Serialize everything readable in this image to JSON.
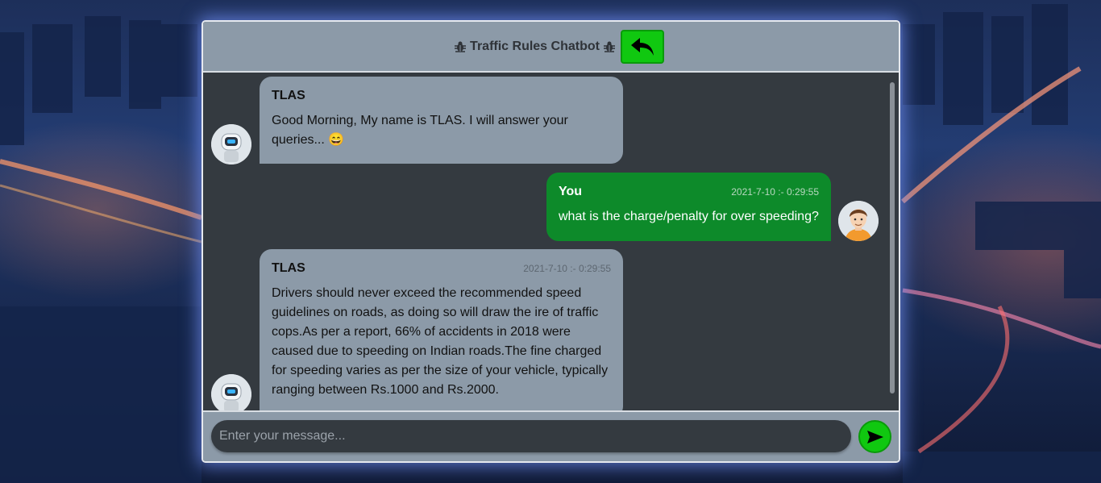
{
  "header": {
    "title": "Traffic Rules Chatbot"
  },
  "messages": [
    {
      "sender": "TLAS",
      "time": "",
      "text": "Good Morning, My name is TLAS. I will answer your queries... 😄"
    },
    {
      "sender": "You",
      "time": "2021-7-10 :- 0:29:55",
      "text": "what is the charge/penalty for over speeding?"
    },
    {
      "sender": "TLAS",
      "time": "2021-7-10 :- 0:29:55",
      "text": "Drivers should never exceed the recommended speed guidelines on roads, as doing so will draw the ire of traffic cops.As per a report, 66% of accidents in 2018 were caused due to speeding on Indian roads.The fine charged for speeding varies as per the size of your vehicle, typically ranging between Rs.1000 and Rs.2000."
    }
  ],
  "input": {
    "placeholder": "Enter your message..."
  },
  "icons": {
    "title": "bug-icon",
    "back": "reply-arrow-icon",
    "send": "send-icon"
  },
  "colors": {
    "accent": "#10c810",
    "user_bubble": "#0d8a2a",
    "bot_bubble": "#8c9aa8"
  }
}
